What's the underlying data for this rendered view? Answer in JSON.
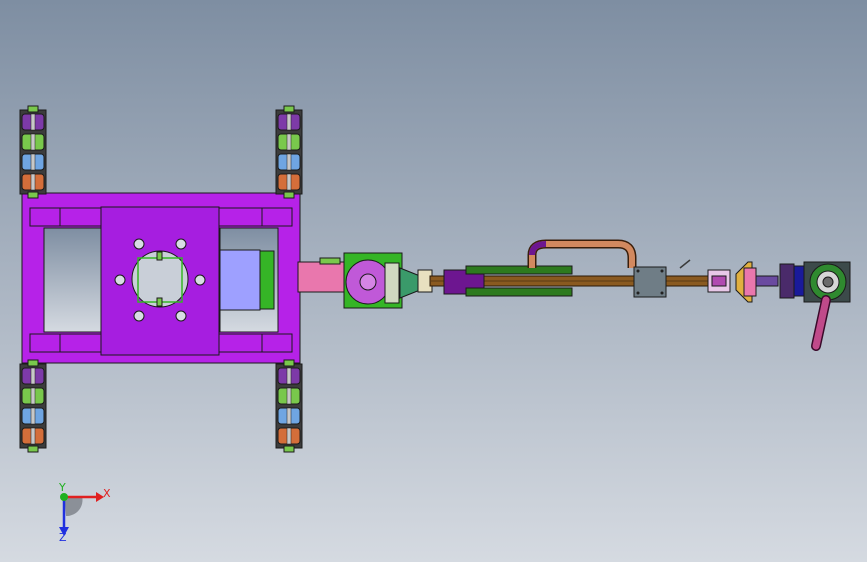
{
  "viewport": {
    "background_top": "#7e8ea2",
    "background_bottom": "#d5dae1",
    "view_orientation": "top view"
  },
  "model": {
    "colors": {
      "frame": "#b622e8",
      "frame_dark": "#6d1690",
      "plate": "#a61ee0",
      "blue_block": "#9ea0ff",
      "green": "#35b526",
      "pink": "#e977ad",
      "rod": "#8a5a20",
      "rod_edge": "#2a1806",
      "copper": "#d2895f",
      "grey": "#6f7d86",
      "wheel_green": "#79c84c",
      "wheel_orange": "#d46e3a",
      "wheel_blue": "#6fa5e2",
      "wheel_purple": "#7d3aa8",
      "dark_purple": "#4a2a6a"
    },
    "parts": [
      "chassis-frame",
      "center-plate",
      "wheel-assembly",
      "mount-block",
      "slide-arm",
      "guide-rod",
      "handle",
      "carriage-block",
      "joint-clevis",
      "end-effector-head",
      "hose-tube"
    ]
  },
  "triad": {
    "x_label": "X",
    "y_label": "Y",
    "z_label": "Z",
    "x_color": "#e02020",
    "y_color": "#20b020",
    "z_color": "#2030e0"
  }
}
